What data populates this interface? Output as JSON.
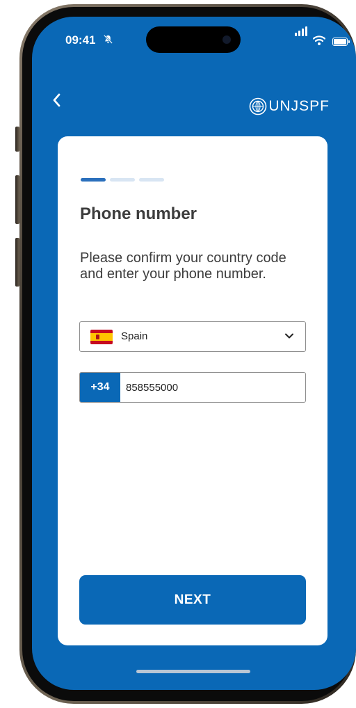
{
  "status_bar": {
    "time": "09:41",
    "icons": [
      "bell-slash-icon",
      "signal-icon",
      "wifi-icon",
      "battery-icon"
    ]
  },
  "header": {
    "back_icon": "chevron-left-icon",
    "logo_text": "UNJSPF",
    "logo_icon": "un-emblem-icon"
  },
  "stepper": {
    "total_steps": 3,
    "current_step": 1,
    "active_color": "#2a6fbc",
    "inactive_color": "#d8e5f3"
  },
  "form": {
    "title": "Phone number",
    "description": "Please confirm your country code and enter your phone number.",
    "country": {
      "flag_icon": "spain-flag-icon",
      "selected": "Spain",
      "dropdown_icon": "chevron-down-icon"
    },
    "phone": {
      "prefix": "+34",
      "value": "858555000"
    },
    "next_label": "NEXT"
  },
  "colors": {
    "primary": "#0a68b6",
    "card_background": "#ffffff",
    "text": "#3d3d3d"
  }
}
